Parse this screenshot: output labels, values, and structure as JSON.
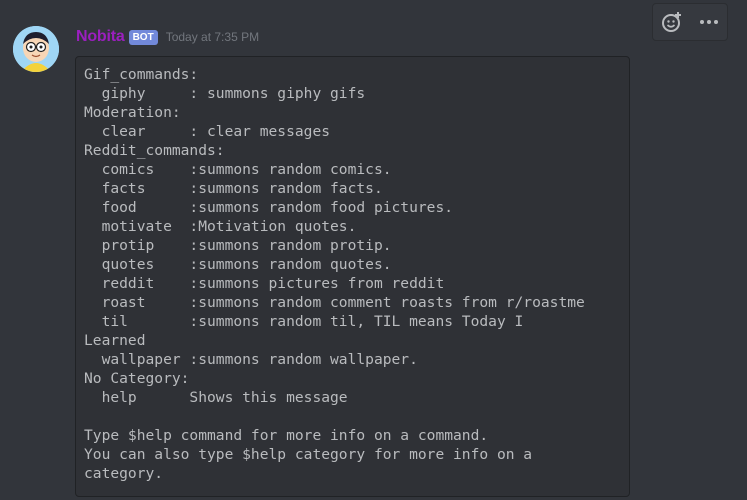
{
  "message": {
    "author": "Nobita",
    "bot_tag": "BOT",
    "timestamp": "Today at 7:35 PM",
    "content": "Gif_commands:\n  giphy     : summons giphy gifs\nModeration:\n  clear     : clear messages\nReddit_commands:\n  comics    :summons random comics.\n  facts     :summons random facts.\n  food      :summons random food pictures.\n  motivate  :Motivation quotes.\n  protip    :summons random protip.\n  quotes    :summons random quotes.\n  reddit    :summons pictures from reddit\n  roast     :summons random comment roasts from r/roastme\n  til       :summons random til, TIL means Today I\nLearned\n  wallpaper :summons random wallpaper.\nNo Category:\n  help      Shows this message\n\nType $help command for more info on a command.\nYou can also type $help category for more info on a\ncategory."
  },
  "toolbar": {
    "icons": [
      "add-reaction-icon",
      "more-options-icon"
    ]
  },
  "colors": {
    "background": "#36393f",
    "message_hover": "#32353b",
    "username": "#9b1fbf",
    "bot_tag": "#7289da",
    "code_background": "#2f3136"
  }
}
